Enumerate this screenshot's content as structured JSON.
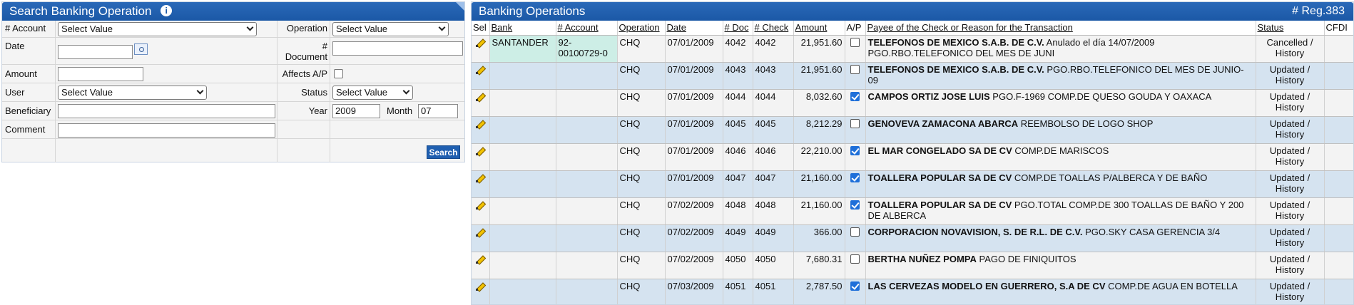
{
  "search": {
    "title": "Search Banking Operation",
    "labels": {
      "account": "# Account",
      "operation": "Operation",
      "date": "Date",
      "document": "# Document",
      "amount": "Amount",
      "affects_ap": "Affects A/P",
      "user": "User",
      "status": "Status",
      "beneficiary": "Beneficiary",
      "year": "Year",
      "month": "Month",
      "comment": "Comment"
    },
    "values": {
      "account": "Select Value",
      "operation": "Select Value",
      "date": "",
      "document": "",
      "amount": "",
      "user": "Select Value",
      "status": "Select Value",
      "beneficiary": "",
      "year": "2009",
      "month": "07",
      "comment": ""
    },
    "search_button": "Search"
  },
  "operations": {
    "title": "Banking Operations",
    "reg_count": "# Reg.383",
    "columns": [
      "Sel",
      "Bank",
      "# Account",
      "Operation",
      "Date",
      "# Doc",
      "# Check",
      "Amount",
      "A/P",
      "Payee of the Check or Reason for the Transaction",
      "Status",
      "CFDI"
    ],
    "rows": [
      {
        "bank": "SANTANDER",
        "account": "92-00100729-0",
        "operation": "CHQ",
        "date": "07/01/2009",
        "doc": "4042",
        "check": "4042",
        "amount": "21,951.60",
        "ap": false,
        "payee": "TELEFONOS DE MEXICO S.A.B. DE C.V.",
        "reason": " Anulado el día 14/07/2009 PGO.RBO.TELEFONICO DEL MES DE JUNI",
        "status": "Cancelled / History",
        "cfdi": ""
      },
      {
        "bank": "",
        "account": "",
        "operation": "CHQ",
        "date": "07/01/2009",
        "doc": "4043",
        "check": "4043",
        "amount": "21,951.60",
        "ap": false,
        "payee": "TELEFONOS DE MEXICO S.A.B. DE C.V.",
        "reason": " PGO.RBO.TELEFONICO DEL MES DE JUNIO-09",
        "status": "Updated / History",
        "cfdi": ""
      },
      {
        "bank": "",
        "account": "",
        "operation": "CHQ",
        "date": "07/01/2009",
        "doc": "4044",
        "check": "4044",
        "amount": "8,032.60",
        "ap": true,
        "payee": "CAMPOS ORTIZ JOSE LUIS",
        "reason": " PGO.F-1969 COMP.DE QUESO GOUDA Y OAXACA",
        "status": "Updated / History",
        "cfdi": ""
      },
      {
        "bank": "",
        "account": "",
        "operation": "CHQ",
        "date": "07/01/2009",
        "doc": "4045",
        "check": "4045",
        "amount": "8,212.29",
        "ap": false,
        "payee": "GENOVEVA ZAMACONA ABARCA",
        "reason": " REEMBOLSO DE LOGO SHOP",
        "status": "Updated / History",
        "cfdi": ""
      },
      {
        "bank": "",
        "account": "",
        "operation": "CHQ",
        "date": "07/01/2009",
        "doc": "4046",
        "check": "4046",
        "amount": "22,210.00",
        "ap": true,
        "payee": "EL MAR CONGELADO SA DE CV",
        "reason": " COMP.DE MARISCOS",
        "status": "Updated / History",
        "cfdi": ""
      },
      {
        "bank": "",
        "account": "",
        "operation": "CHQ",
        "date": "07/01/2009",
        "doc": "4047",
        "check": "4047",
        "amount": "21,160.00",
        "ap": true,
        "payee": "TOALLERA POPULAR SA DE CV",
        "reason": " COMP.DE TOALLAS P/ALBERCA Y DE BAÑO",
        "status": "Updated / History",
        "cfdi": ""
      },
      {
        "bank": "",
        "account": "",
        "operation": "CHQ",
        "date": "07/02/2009",
        "doc": "4048",
        "check": "4048",
        "amount": "21,160.00",
        "ap": true,
        "payee": "TOALLERA POPULAR SA DE CV",
        "reason": " PGO.TOTAL COMP.DE 300 TOALLAS DE BAÑO Y 200 DE ALBERCA",
        "status": "Updated / History",
        "cfdi": ""
      },
      {
        "bank": "",
        "account": "",
        "operation": "CHQ",
        "date": "07/02/2009",
        "doc": "4049",
        "check": "4049",
        "amount": "366.00",
        "ap": false,
        "payee": "CORPORACION NOVAVISION, S. DE R.L. DE C.V.",
        "reason": " PGO.SKY CASA GERENCIA 3/4",
        "status": "Updated / History",
        "cfdi": ""
      },
      {
        "bank": "",
        "account": "",
        "operation": "CHQ",
        "date": "07/02/2009",
        "doc": "4050",
        "check": "4050",
        "amount": "7,680.31",
        "ap": false,
        "payee": "BERTHA NUÑEZ POMPA",
        "reason": " PAGO DE FINIQUITOS",
        "status": "Updated / History",
        "cfdi": ""
      },
      {
        "bank": "",
        "account": "",
        "operation": "CHQ",
        "date": "07/03/2009",
        "doc": "4051",
        "check": "4051",
        "amount": "2,787.50",
        "ap": true,
        "payee": "LAS CERVEZAS MODELO EN GUERRERO, S.A DE CV",
        "reason": " COMP.DE AGUA EN BOTELLA",
        "status": "Updated / History",
        "cfdi": ""
      }
    ]
  }
}
